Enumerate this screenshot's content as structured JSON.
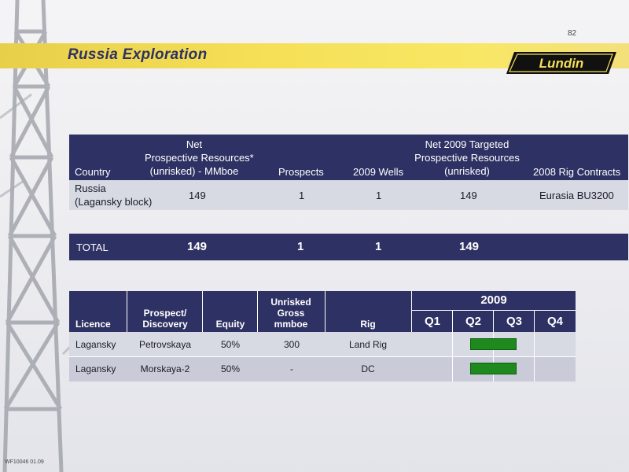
{
  "page_number": "82",
  "title": "Russia Exploration",
  "logo_text": "Lundin",
  "footer_code": "WF10046 01.09",
  "colors": {
    "navy": "#2e3163",
    "banner_yellow": "#f5df56",
    "gantt_green": "#1e8a1e"
  },
  "table1": {
    "headers": {
      "country": "Country",
      "net_line1": "Net",
      "net_line2": "Prospective Resources*",
      "net_line3": "(unrisked) - MMboe",
      "prospects": "Prospects",
      "wells": "2009 Wells",
      "targeted_line1": "Net 2009 Targeted",
      "targeted_line2": "Prospective Resources",
      "targeted_line3": "(unrisked)",
      "rig_contracts": "2008 Rig Contracts"
    },
    "row": {
      "country_line1": "Russia",
      "country_line2": "(Lagansky block)",
      "net": "149",
      "prospects": "1",
      "wells": "1",
      "targeted": "149",
      "rig_contract": "Eurasia BU3200"
    },
    "total": {
      "label": "TOTAL",
      "net": "149",
      "prospects": "1",
      "wells": "1",
      "targeted": "149"
    }
  },
  "table2": {
    "headers": {
      "licence": "Licence",
      "prospect_line1": "Prospect/",
      "prospect_line2": "Discovery",
      "equity": "Equity",
      "unrisked_line1": "Unrisked",
      "unrisked_line2": "Gross",
      "unrisked_line3": "mmboe",
      "rig": "Rig",
      "year": "2009",
      "quarters": [
        "Q1",
        "Q2",
        "Q3",
        "Q4"
      ]
    },
    "rows": [
      {
        "licence": "Lagansky",
        "prospect": "Petrovskaya",
        "equity": "50%",
        "unrisked": "300",
        "rig": "Land Rig",
        "activity_quarters": [
          "Q2",
          "Q3"
        ]
      },
      {
        "licence": "Lagansky",
        "prospect": "Morskaya-2",
        "equity": "50%",
        "unrisked": "-",
        "rig": "DC",
        "activity_quarters": [
          "Q2",
          "Q3"
        ]
      }
    ]
  }
}
